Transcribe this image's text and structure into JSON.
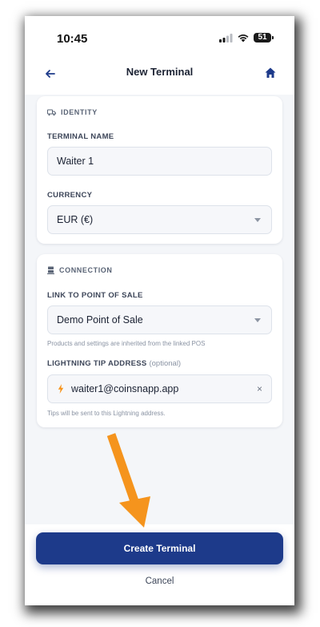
{
  "status_bar": {
    "time": "10:45",
    "battery_level": "51"
  },
  "nav": {
    "title": "New Terminal"
  },
  "identity": {
    "section_title": "IDENTITY",
    "name_label": "TERMINAL NAME",
    "name_value": "Waiter 1",
    "currency_label": "CURRENCY",
    "currency_value": "EUR (€)"
  },
  "connection": {
    "section_title": "CONNECTION",
    "pos_label": "LINK TO POINT OF SALE",
    "pos_value": "Demo Point of Sale",
    "pos_hint": "Products and settings are inherited from the linked POS",
    "tip_label": "LIGHTNING TIP ADDRESS",
    "tip_optional": "(optional)",
    "tip_value": "waiter1@coinsnapp.app",
    "tip_hint": "Tips will be sent to this Lightning address.",
    "clear_symbol": "×"
  },
  "actions": {
    "create_label": "Create Terminal",
    "cancel_label": "Cancel"
  },
  "colors": {
    "primary": "#1d3a8a",
    "lightning": "#f7931a",
    "annotation_arrow": "#f5941d"
  }
}
